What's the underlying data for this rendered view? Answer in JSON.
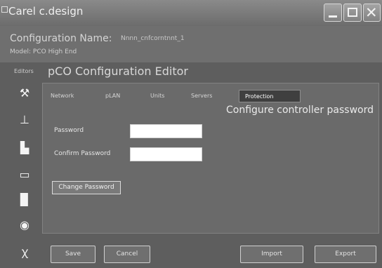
{
  "window": {
    "title": "Carel c.design",
    "min_icon": "minimize-icon",
    "max_icon": "maximize-icon",
    "close_glyph": "✕"
  },
  "header": {
    "config_name_label": "Configuration Name:",
    "config_name_value": "Nnnn_cnfcorntnnt_1",
    "model": "Model: PCO High End"
  },
  "sidebar": {
    "label": "Editors",
    "items": [
      {
        "icon": "wrench-icon",
        "glyph": "⚒"
      },
      {
        "icon": "network-icon",
        "glyph": "⊥"
      },
      {
        "icon": "chart-icon",
        "glyph": "▙"
      },
      {
        "icon": "display-icon",
        "glyph": "▭"
      },
      {
        "icon": "document-icon",
        "glyph": "▉"
      },
      {
        "icon": "disc-icon",
        "glyph": "◉"
      },
      {
        "icon": "users-icon",
        "glyph": "ꭓ"
      }
    ]
  },
  "editor": {
    "title": "pCO Configuration Editor",
    "tabs": [
      {
        "label": "Network"
      },
      {
        "label": "pLAN"
      },
      {
        "label": "Units"
      },
      {
        "label": "Servers"
      },
      {
        "label": "Protection"
      }
    ],
    "active_tab": "Protection",
    "section_title": "Configure controller password",
    "form": {
      "password_label": "Password",
      "password_value": "",
      "confirm_label": "Confirm Password",
      "confirm_value": "",
      "change_button": "Change Password"
    }
  },
  "footer": {
    "save": "Save",
    "cancel": "Cancel",
    "import": "Import",
    "export": "Export"
  }
}
